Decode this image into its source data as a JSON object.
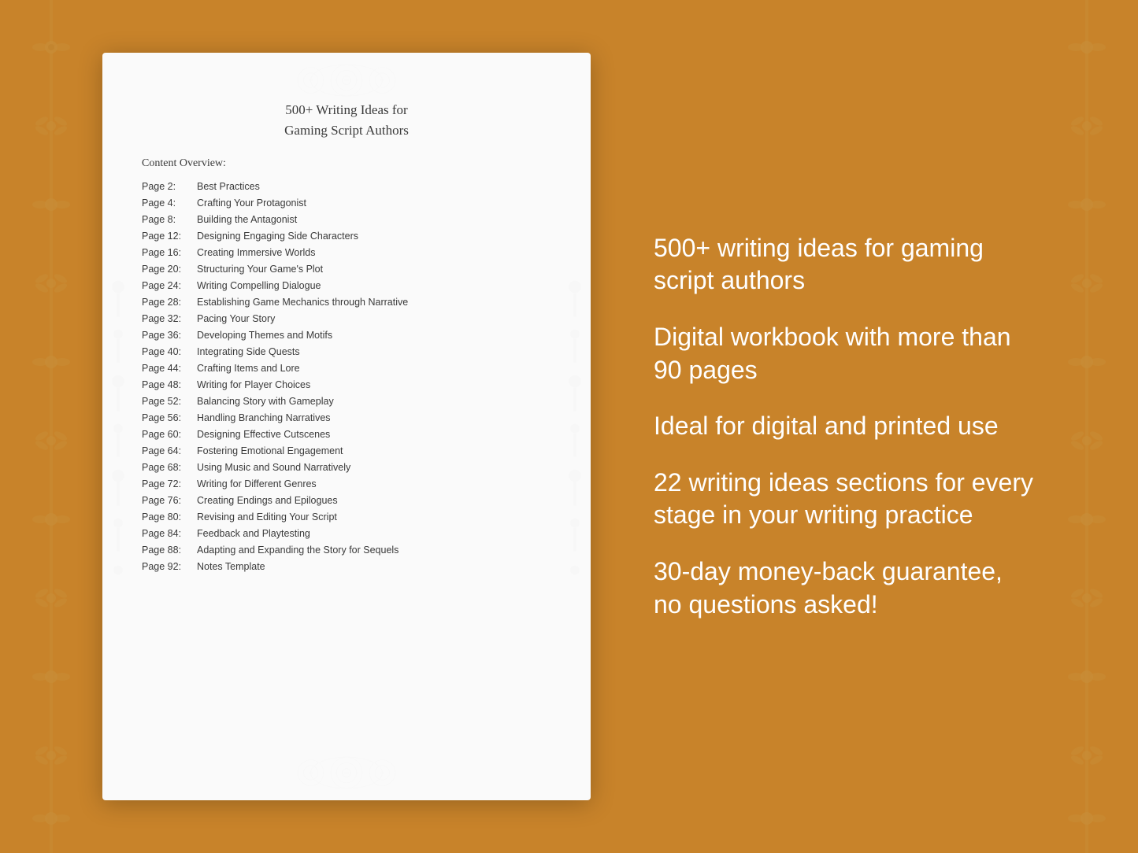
{
  "background": {
    "color": "#C8832A"
  },
  "document": {
    "title_line1": "500+ Writing Ideas for",
    "title_line2": "Gaming Script Authors",
    "content_overview_label": "Content Overview:",
    "toc": [
      {
        "page": "Page  2:",
        "title": "Best Practices"
      },
      {
        "page": "Page  4:",
        "title": "Crafting Your Protagonist"
      },
      {
        "page": "Page  8:",
        "title": "Building the Antagonist"
      },
      {
        "page": "Page 12:",
        "title": "Designing Engaging Side Characters"
      },
      {
        "page": "Page 16:",
        "title": "Creating Immersive Worlds"
      },
      {
        "page": "Page 20:",
        "title": "Structuring Your Game's Plot"
      },
      {
        "page": "Page 24:",
        "title": "Writing Compelling Dialogue"
      },
      {
        "page": "Page 28:",
        "title": "Establishing Game Mechanics through Narrative"
      },
      {
        "page": "Page 32:",
        "title": "Pacing Your Story"
      },
      {
        "page": "Page 36:",
        "title": "Developing Themes and Motifs"
      },
      {
        "page": "Page 40:",
        "title": "Integrating Side Quests"
      },
      {
        "page": "Page 44:",
        "title": "Crafting Items and Lore"
      },
      {
        "page": "Page 48:",
        "title": "Writing for Player Choices"
      },
      {
        "page": "Page 52:",
        "title": "Balancing Story with Gameplay"
      },
      {
        "page": "Page 56:",
        "title": "Handling Branching Narratives"
      },
      {
        "page": "Page 60:",
        "title": "Designing Effective Cutscenes"
      },
      {
        "page": "Page 64:",
        "title": "Fostering Emotional Engagement"
      },
      {
        "page": "Page 68:",
        "title": "Using Music and Sound Narratively"
      },
      {
        "page": "Page 72:",
        "title": "Writing for Different Genres"
      },
      {
        "page": "Page 76:",
        "title": "Creating Endings and Epilogues"
      },
      {
        "page": "Page 80:",
        "title": "Revising and Editing Your Script"
      },
      {
        "page": "Page 84:",
        "title": "Feedback and Playtesting"
      },
      {
        "page": "Page 88:",
        "title": "Adapting and Expanding the Story for Sequels"
      },
      {
        "page": "Page 92:",
        "title": "Notes Template"
      }
    ]
  },
  "features": [
    "500+ writing ideas for gaming script authors",
    "Digital workbook with more than 90 pages",
    "Ideal for digital and printed use",
    "22 writing ideas sections for every stage in your writing practice",
    "30-day money-back guarantee, no questions asked!"
  ]
}
